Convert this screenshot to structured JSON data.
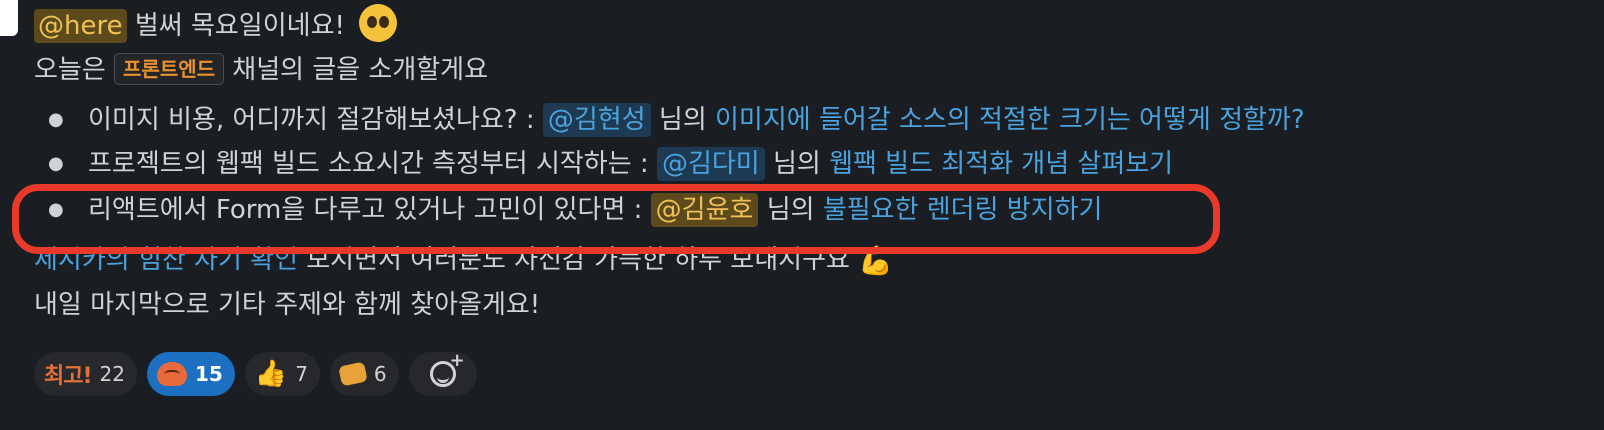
{
  "message": {
    "line1": {
      "mention": "@here",
      "text": " 벌써 목요일이네요!",
      "emoji": "pleading-face-emoji"
    },
    "line2": {
      "before": "오늘은 ",
      "channel": "프론트엔드",
      "after": " 채널의 글을 소개할게요"
    },
    "bullets": [
      {
        "text": "이미지 비용, 어디까지 절감해보셨나요? : ",
        "mention": "@김현성",
        "mid": " 님의 ",
        "link": "이미지에 들어갈 소스의 적절한 크기는 어떻게 정할까?"
      },
      {
        "text": "프로젝트의 웹팩 빌드 소요시간 측정부터 시작하는 : ",
        "mention": "@김다미",
        "mid": " 님의 ",
        "link": "웹팩 빌드 최적화 개념 살펴보기"
      },
      {
        "text": "리액트에서 Form을 다루고 있거나 고민이 있다면 : ",
        "mention": "@김윤호",
        "mid": " 님의 ",
        "link": "불필요한 렌더링 방지하기"
      }
    ],
    "line3": {
      "link": "제시카의 힘찬 자기 확인",
      "text": " 보시면서 여러분도 자신감 가득한 하루 보내시구요",
      "emoji": "💪"
    },
    "line4": "내일 마지막으로 기타 주제와 함께 찾아올게요!"
  },
  "reactions": [
    {
      "emoji_name": "choego-text-emoji",
      "glyph": "최고!",
      "count": "22",
      "active": false
    },
    {
      "emoji_name": "blushing-blob-emoji",
      "count": "15",
      "active": true
    },
    {
      "emoji_name": "thumbs-up-emoji",
      "glyph": "👍",
      "count": "7",
      "active": false
    },
    {
      "emoji_name": "sleeping-emoji",
      "count": "6",
      "active": false
    }
  ],
  "colors": {
    "background": "#1a1d21",
    "mention_here": "#f0c156",
    "link": "#4aa3df",
    "channel": "#e8912d",
    "highlight_border": "#e8392b",
    "active_reaction": "#1d6fc2"
  }
}
